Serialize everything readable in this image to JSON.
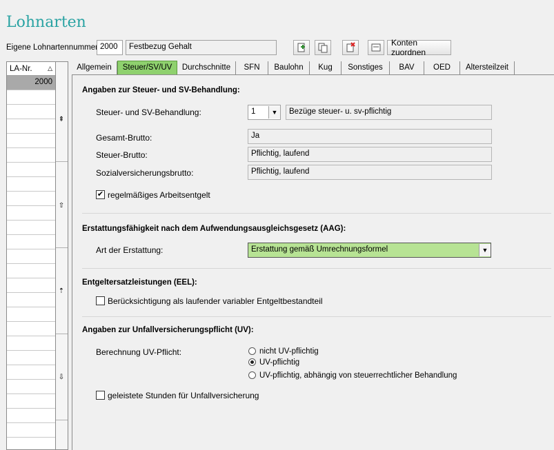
{
  "title": "Lohnarten",
  "header": {
    "own_number_label": "Eigene Lohnartennummer:",
    "number_value": "2000",
    "name_value": "Festbezug Gehalt",
    "assign_accounts_label": "Konten zuordnen"
  },
  "list": {
    "column": "LA-Nr.",
    "rows": [
      "2000"
    ]
  },
  "tabs": [
    {
      "label": "Allgemein"
    },
    {
      "label": "Steuer/SV/UV",
      "active": true
    },
    {
      "label": "Durchschnitte"
    },
    {
      "label": "SFN"
    },
    {
      "label": "Baulohn"
    },
    {
      "label": "Kug"
    },
    {
      "label": "Sonstiges"
    },
    {
      "label": "BAV"
    },
    {
      "label": "OED"
    },
    {
      "label": "Altersteilzeit"
    }
  ],
  "section_tax": {
    "heading": "Angaben zur Steuer- und SV-Behandlung:",
    "treatment_label": "Steuer- und SV-Behandlung:",
    "treatment_code": "1",
    "treatment_text": "Bezüge steuer- u. sv-pflichtig",
    "gross_total_label": "Gesamt-Brutto:",
    "gross_total_value": "Ja",
    "tax_gross_label": "Steuer-Brutto:",
    "tax_gross_value": "Pflichtig, laufend",
    "social_gross_label": "Sozialversicherungsbrutto:",
    "social_gross_value": "Pflichtig, laufend",
    "regular_pay_label": "regelmäßiges Arbeitsentgelt",
    "regular_pay_checked": "✔"
  },
  "section_aag": {
    "heading": "Erstattungsfähigkeit nach dem Aufwendungsausgleichsgesetz (AAG):",
    "type_label": "Art der Erstattung:",
    "type_value": "Erstattung gemäß Umrechnungsformel"
  },
  "section_eel": {
    "heading": "Entgeltersatzleistungen (EEL):",
    "variable_label": "Berücksichtigung als laufender variabler Entgeltbestandteil"
  },
  "section_uv": {
    "heading": "Angaben zur Unfallversicherungspflicht (UV):",
    "calc_label": "Berechnung UV-Pflicht:",
    "options": [
      "nicht UV-pflichtig",
      "UV-pflichtig",
      "UV-pflichtig, abhängig von steuerrechtlicher Behandlung"
    ],
    "hours_label": "geleistete Stunden für Unfallversicherung"
  },
  "colors": {
    "active_tab": "#8fd16e",
    "title": "#2aa3a3",
    "highlight": "#b7e394"
  }
}
